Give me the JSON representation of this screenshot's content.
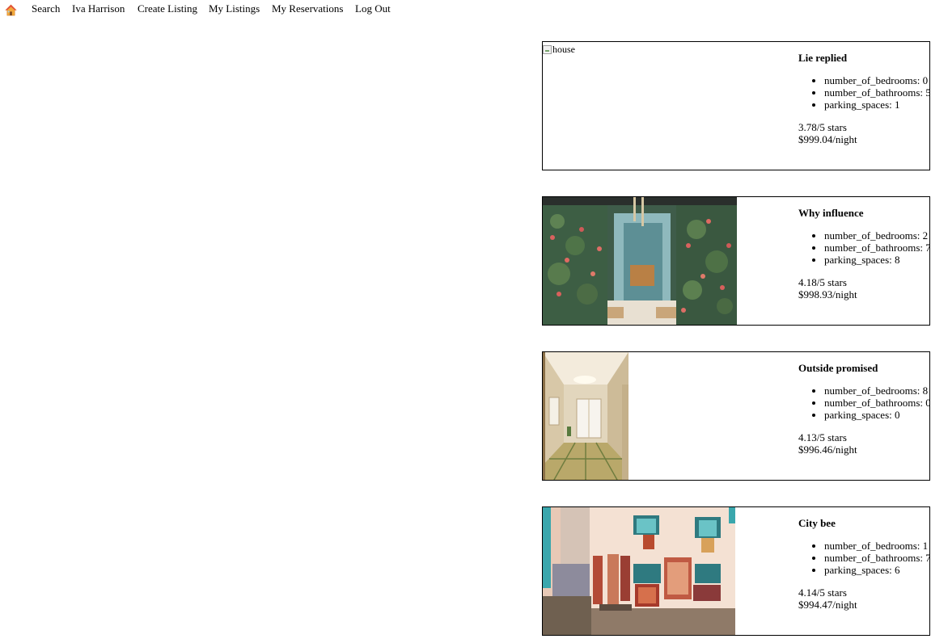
{
  "nav": {
    "home_icon": "house-icon",
    "links": [
      "Search",
      "Iva Harrison",
      "Create Listing",
      "My Listings",
      "My Reservations",
      "Log Out"
    ]
  },
  "listings": [
    {
      "image_alt": "house",
      "image_broken": true,
      "title": "Lie replied",
      "number_of_bedrooms": "number_of_bedrooms: 0",
      "number_of_bathrooms": "number_of_bathrooms: 5",
      "parking_spaces": "parking_spaces: 1",
      "rating": "3.78/5 stars",
      "price": "$999.04/night"
    },
    {
      "image_subject": "doorway framed by flowering vines",
      "title": "Why influence",
      "number_of_bedrooms": "number_of_bedrooms: 2",
      "number_of_bathrooms": "number_of_bathrooms: 7",
      "parking_spaces": "parking_spaces: 8",
      "rating": "4.18/5 stars",
      "price": "$998.93/night"
    },
    {
      "image_subject": "tatami room with window",
      "title": "Outside promised",
      "number_of_bedrooms": "number_of_bedrooms: 8",
      "number_of_bathrooms": "number_of_bathrooms: 0",
      "parking_spaces": "parking_spaces: 0",
      "rating": "4.13/5 stars",
      "price": "$996.46/night"
    },
    {
      "image_subject": "courtyard with hanging rugs",
      "title": "City bee",
      "number_of_bedrooms": "number_of_bedrooms: 1",
      "number_of_bathrooms": "number_of_bathrooms: 7",
      "parking_spaces": "parking_spaces: 6",
      "rating": "4.14/5 stars",
      "price": "$994.47/night"
    }
  ]
}
